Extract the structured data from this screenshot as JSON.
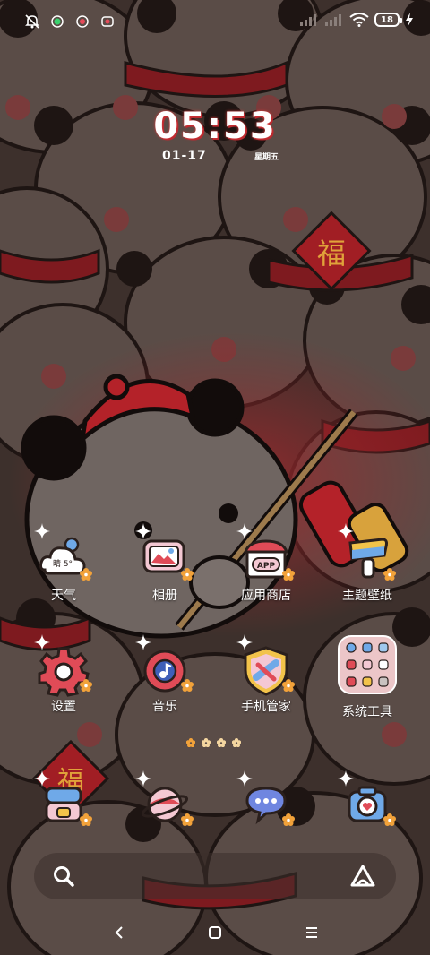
{
  "status_bar": {
    "battery_level": "18",
    "icons": [
      "bell-off-icon",
      "green-dot-icon",
      "notif-icon",
      "notif-icon-2",
      "signal-icon",
      "signal-icon-2",
      "wifi-icon",
      "battery-icon",
      "charging-icon"
    ]
  },
  "clock": {
    "time": "05:53",
    "date": "01-17",
    "weekday": "星期五"
  },
  "weather_badge": "晴 5°",
  "apps": [
    {
      "label": "天气",
      "icon": "weather-icon"
    },
    {
      "label": "相册",
      "icon": "gallery-icon"
    },
    {
      "label": "应用商店",
      "icon": "app-store-icon"
    },
    {
      "label": "主题壁纸",
      "icon": "themes-icon"
    },
    {
      "label": "设置",
      "icon": "settings-icon"
    },
    {
      "label": "音乐",
      "icon": "music-icon"
    },
    {
      "label": "手机管家",
      "icon": "security-icon"
    },
    {
      "label": "系统工具",
      "icon": "system-tools-folder-icon"
    }
  ],
  "dock": [
    {
      "icon": "game-icon"
    },
    {
      "icon": "browser-icon"
    },
    {
      "icon": "messages-icon"
    },
    {
      "icon": "camera-icon"
    }
  ],
  "colors": {
    "background": "#3d302c",
    "accent_red": "#c7242d",
    "icon_outline": "#2a1f1c",
    "sparkle": "#ffffff",
    "flower": "#f2a23a"
  }
}
